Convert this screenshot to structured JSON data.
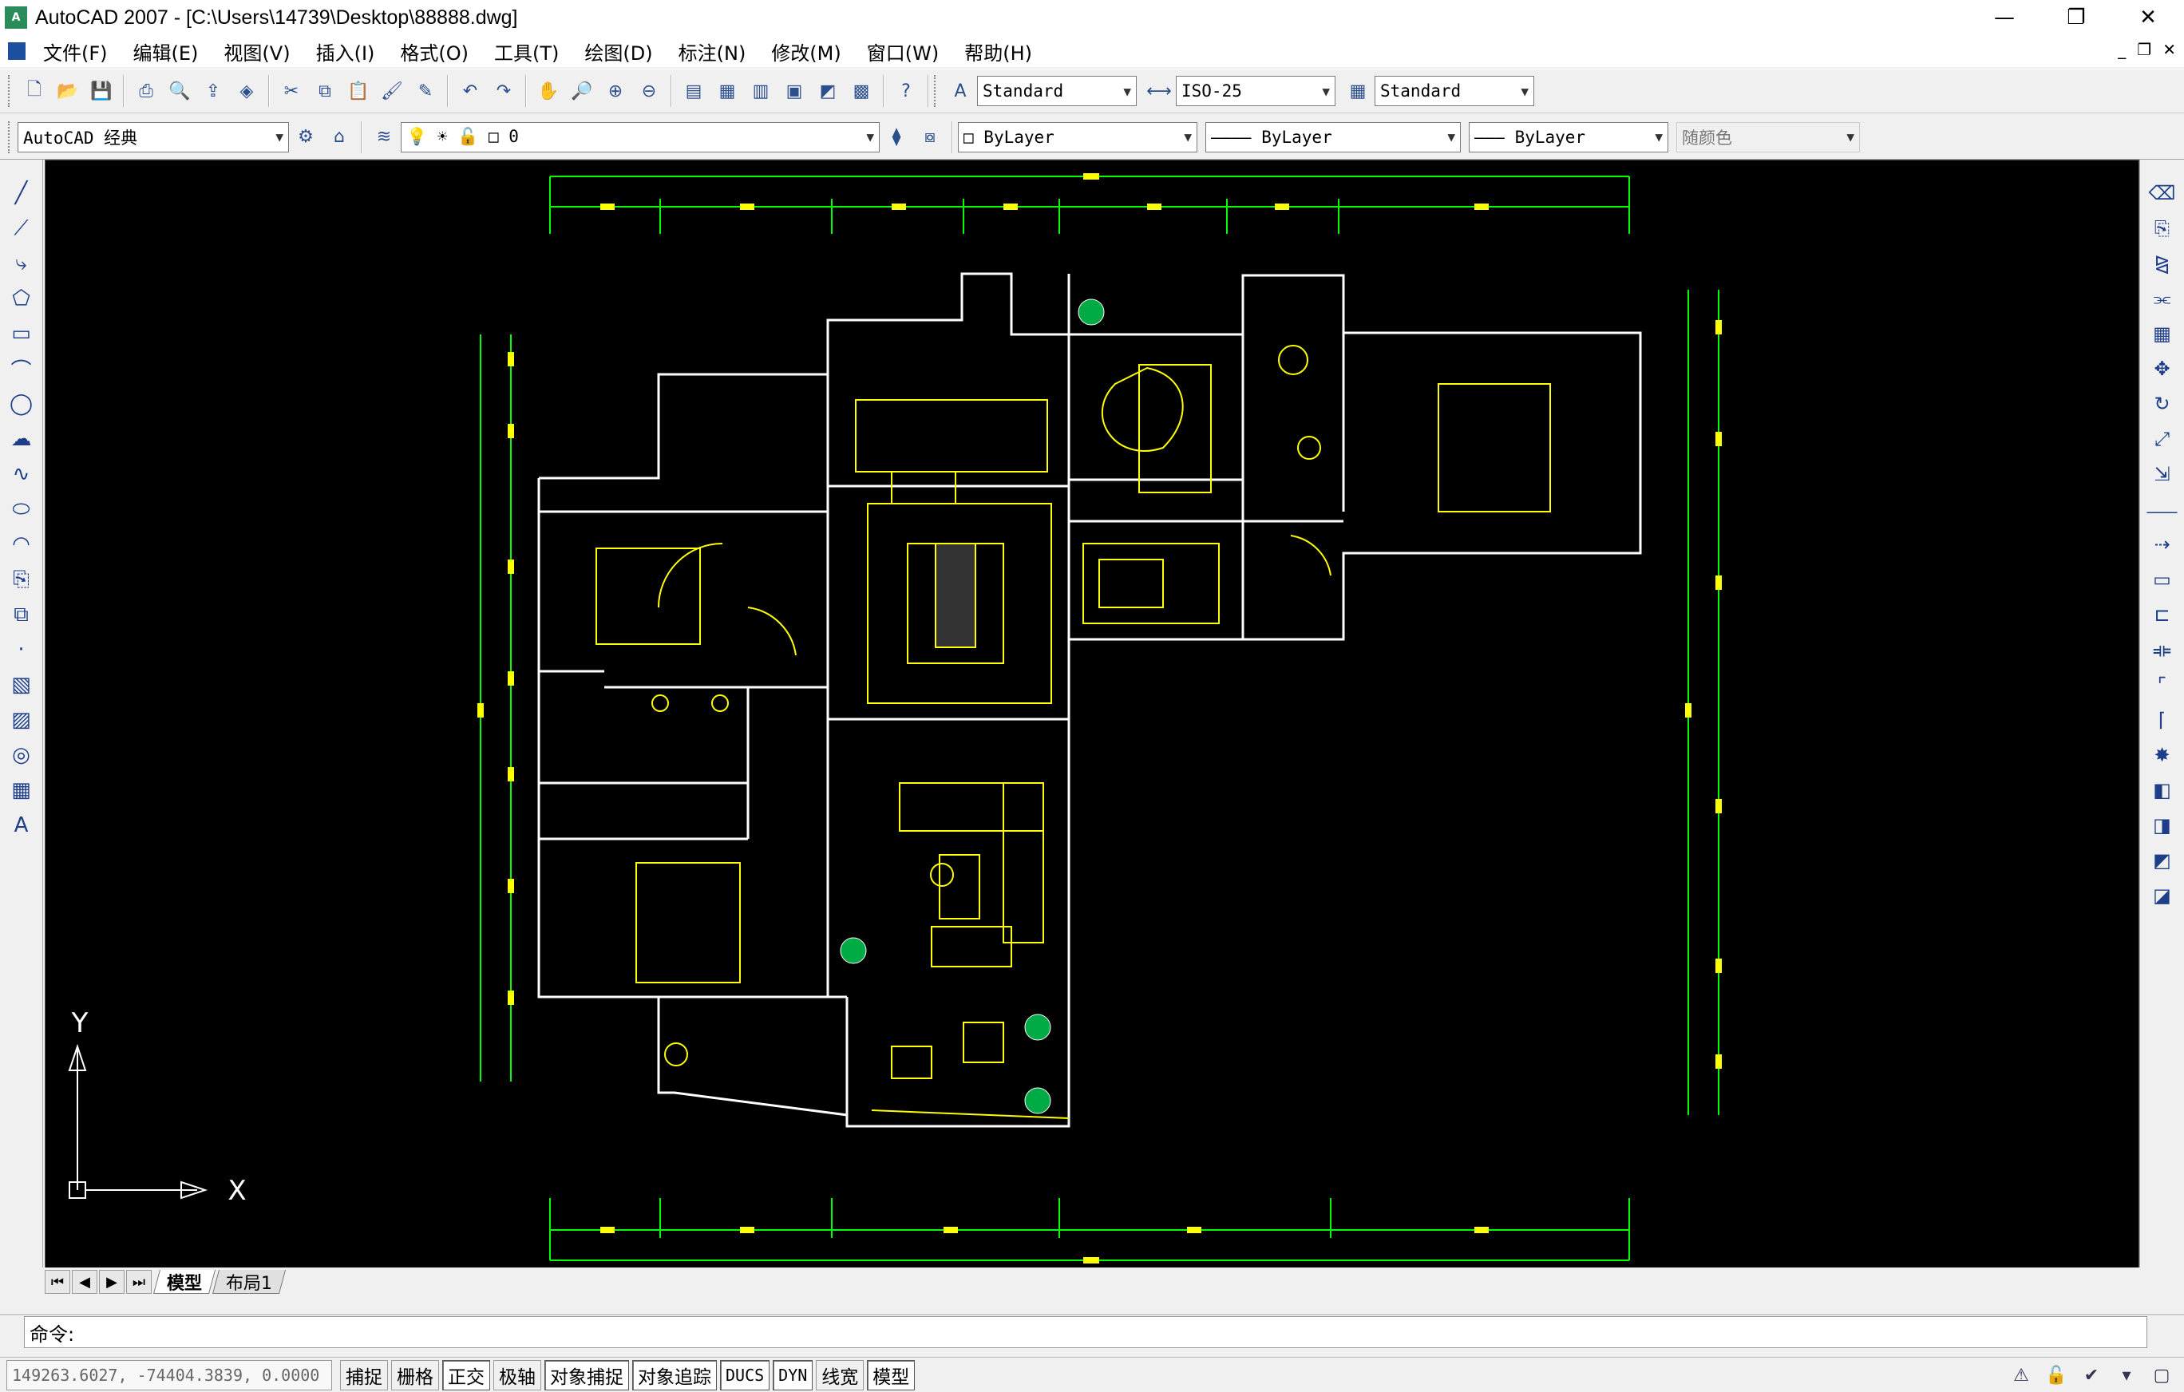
{
  "window": {
    "title": "AutoCAD 2007 - [C:\\Users\\14739\\Desktop\\88888.dwg]",
    "minimize": "—",
    "restore": "❐",
    "close": "✕"
  },
  "menu": {
    "items": [
      "文件(F)",
      "编辑(E)",
      "视图(V)",
      "插入(I)",
      "格式(O)",
      "工具(T)",
      "绘图(D)",
      "标注(N)",
      "修改(M)",
      "窗口(W)",
      "帮助(H)"
    ],
    "mdi_min": "_",
    "mdi_restore": "❐",
    "mdi_close": "✕"
  },
  "toolbar1": {
    "text_style": "Standard",
    "dim_style": "ISO-25",
    "table_style": "Standard"
  },
  "toolbar2": {
    "workspace": "AutoCAD 经典",
    "layer": "0",
    "color": "ByLayer",
    "linetype": "ByLayer",
    "lineweight": "ByLayer",
    "plot_style": "随颜色"
  },
  "canvas": {
    "background": "#000000",
    "line_color": "#ffff00",
    "wall_color": "#ffffff",
    "dim_color": "#00ff00",
    "ucs_x": "X",
    "ucs_y": "Y"
  },
  "layout_tabs": {
    "model": "模型",
    "layout1": "布局1"
  },
  "command": {
    "prompt": "命令:"
  },
  "status": {
    "coords": "149263.6027, -74404.3839, 0.0000",
    "buttons": [
      {
        "label": "捕捉",
        "on": false
      },
      {
        "label": "栅格",
        "on": false
      },
      {
        "label": "正交",
        "on": true
      },
      {
        "label": "极轴",
        "on": false
      },
      {
        "label": "对象捕捉",
        "on": true
      },
      {
        "label": "对象追踪",
        "on": true
      },
      {
        "label": "DUCS",
        "on": true
      },
      {
        "label": "DYN",
        "on": true
      },
      {
        "label": "线宽",
        "on": false
      },
      {
        "label": "模型",
        "on": true
      }
    ]
  }
}
